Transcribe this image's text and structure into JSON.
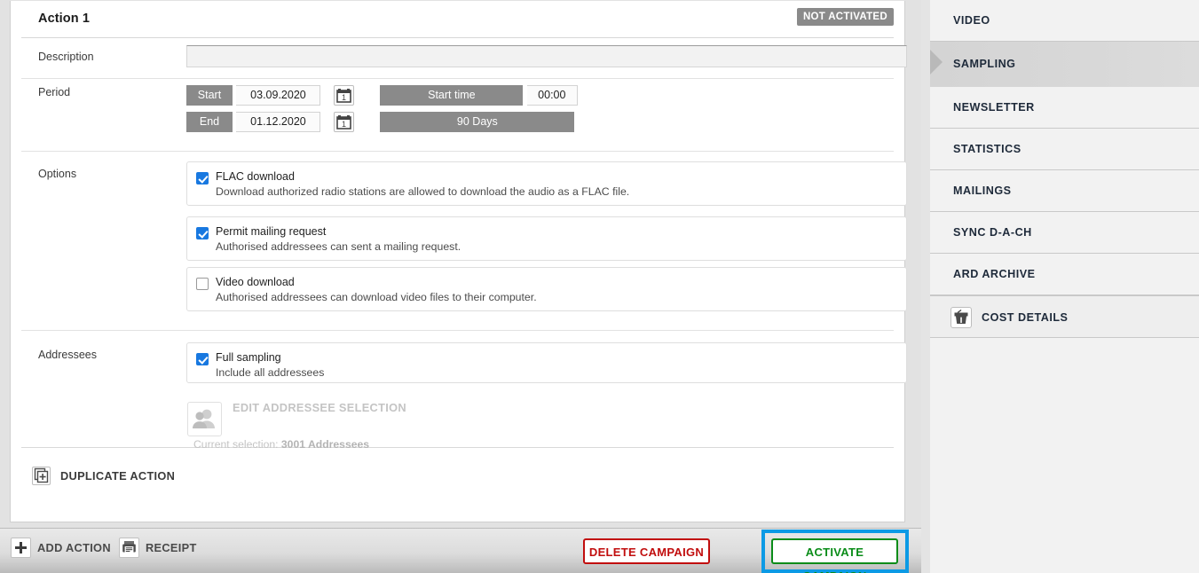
{
  "card": {
    "title": "Action 1",
    "status_badge": "NOT ACTIVATED"
  },
  "description": {
    "label": "Description",
    "value": "",
    "placeholder": ""
  },
  "period": {
    "label": "Period",
    "start_label": "Start",
    "start_value": "03.09.2020",
    "end_label": "End",
    "end_value": "01.12.2020",
    "start_time_label": "Start time",
    "start_time_value": "00:00",
    "duration": "90 Days",
    "calendar_icon": "calendar-icon"
  },
  "options": {
    "label": "Options",
    "items": [
      {
        "title": "FLAC download",
        "desc": "Download authorized radio stations are allowed to download the audio as a FLAC file.",
        "checked": true
      },
      {
        "title": "Permit mailing request",
        "desc": "Authorised addressees can sent a mailing request.",
        "checked": true
      },
      {
        "title": "Video download",
        "desc": "Authorised addressees can download video files to their computer.",
        "checked": false
      }
    ]
  },
  "addressees": {
    "label": "Addressees",
    "full_sampling_title": "Full sampling",
    "full_sampling_desc": "Include all addressees",
    "full_sampling_checked": true,
    "edit_selection_label": "EDIT ADDRESSEE SELECTION",
    "edit_selection_icon": "user-group-icon",
    "current_selection_prefix": "Current selection: ",
    "current_selection_value": "3001 Addressees"
  },
  "duplicate_action": {
    "label": "DUPLICATE ACTION",
    "icon": "duplicate-icon"
  },
  "toolbar": {
    "add_action_label": "ADD ACTION",
    "add_action_icon": "plus-icon",
    "receipt_label": "RECEIPT",
    "receipt_icon": "receipt-icon",
    "delete_campaign_label": "DELETE CAMPAIGN",
    "activate_campaign_label": "ACTIVATE CAMPAIGN"
  },
  "sidebar": {
    "items": [
      {
        "label": "VIDEO",
        "selected": false
      },
      {
        "label": "SAMPLING",
        "selected": true
      },
      {
        "label": "NEWSLETTER",
        "selected": false
      },
      {
        "label": "STATISTICS",
        "selected": false
      },
      {
        "label": "MAILINGS",
        "selected": false
      },
      {
        "label": "SYNC D-A-CH",
        "selected": false
      },
      {
        "label": "ARD ARCHIVE",
        "selected": false
      }
    ],
    "cost_details": {
      "label": "COST DETAILS",
      "icon": "basket-icon"
    }
  },
  "colors": {
    "highlight_blue": "#0c9ae5",
    "delete_red": "#c10d0d",
    "activate_green": "#0a8c18",
    "checkbox_blue": "#1878e0",
    "badge_grey": "#8a8a8a"
  }
}
